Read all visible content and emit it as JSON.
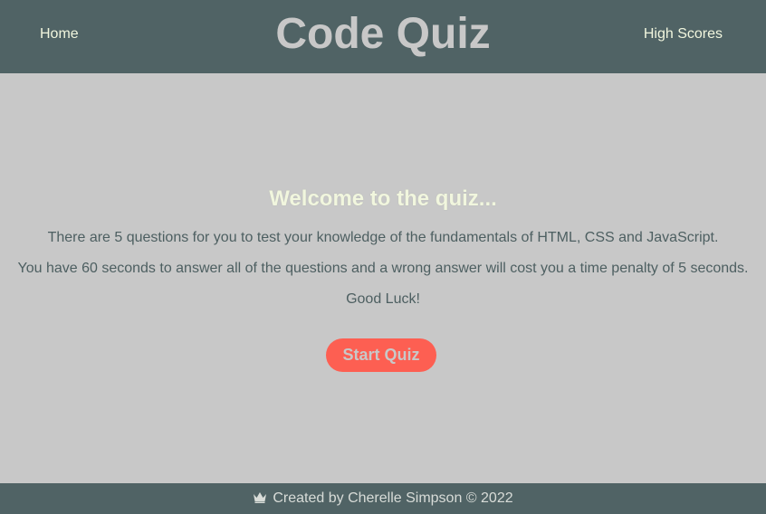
{
  "header": {
    "home_label": "Home",
    "title": "Code Quiz",
    "high_scores_label": "High Scores"
  },
  "main": {
    "heading": "Welcome to the quiz...",
    "paragraphs": [
      "There are 5 questions for you to test your knowledge of the fundamentals of HTML, CSS and JavaScript.",
      "You have 60 seconds to answer all of the questions and a wrong answer will cost you a time penalty of 5 seconds.",
      "Good Luck!"
    ],
    "start_button_label": "Start Quiz"
  },
  "footer": {
    "icon": "crown-icon",
    "text": "Created by Cherelle Simpson © 2022"
  },
  "colors": {
    "header_bg": "#506365",
    "page_bg": "#c8c8c8",
    "accent_button": "#fd5f52",
    "nav_text": "#f1f6de",
    "body_text": "#4d5f61"
  }
}
